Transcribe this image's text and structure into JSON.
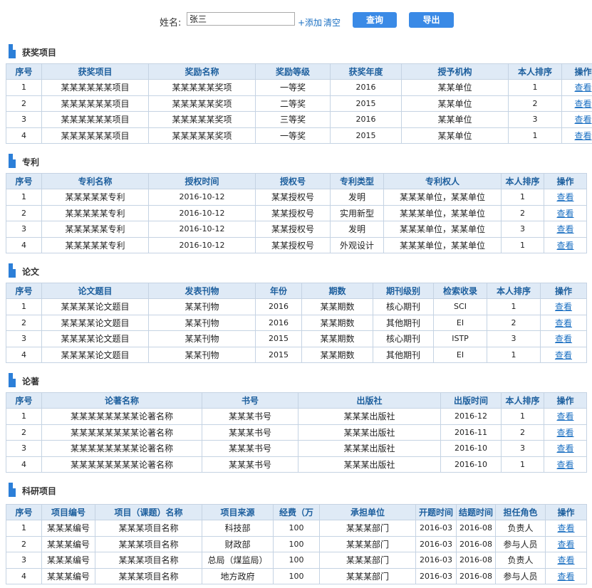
{
  "search": {
    "label": "姓名:",
    "value": "张三",
    "add": "+添加",
    "clear": "清空",
    "query": "查询",
    "export": "导出"
  },
  "view_label": "查看",
  "sections": [
    {
      "title": "获奖项目",
      "headers": [
        "序号",
        "获奖项目",
        "奖励名称",
        "奖励等级",
        "获奖年度",
        "授予机构",
        "本人排序",
        "操作"
      ],
      "rows": [
        [
          "1",
          "某某某某某某项目",
          "某某某某某奖项",
          "一等奖",
          "2016",
          "某某单位",
          "1"
        ],
        [
          "2",
          "某某某某某某项目",
          "某某某某某奖项",
          "二等奖",
          "2015",
          "某某单位",
          "2"
        ],
        [
          "3",
          "某某某某某某项目",
          "某某某某某奖项",
          "三等奖",
          "2016",
          "某某单位",
          "3"
        ],
        [
          "4",
          "某某某某某某项目",
          "某某某某某奖项",
          "一等奖",
          "2015",
          "某某单位",
          "1"
        ]
      ]
    },
    {
      "title": "专利",
      "headers": [
        "序号",
        "专利名称",
        "授权时间",
        "授权号",
        "专利类型",
        "专利权人",
        "本人排序",
        "操作"
      ],
      "rows": [
        [
          "1",
          "某某某某某专利",
          "2016-10-12",
          "某某授权号",
          "发明",
          "某某某单位，某某单位",
          "1"
        ],
        [
          "2",
          "某某某某某专利",
          "2016-10-12",
          "某某授权号",
          "实用新型",
          "某某某单位，某某单位",
          "2"
        ],
        [
          "3",
          "某某某某某专利",
          "2016-10-12",
          "某某授权号",
          "发明",
          "某某某单位，某某单位",
          "3"
        ],
        [
          "4",
          "某某某某某专利",
          "2016-10-12",
          "某某授权号",
          "外观设计",
          "某某某单位，某某单位",
          "1"
        ]
      ]
    },
    {
      "title": "论文",
      "headers": [
        "序号",
        "论文题目",
        "发表刊物",
        "年份",
        "期数",
        "期刊级别",
        "检索收录",
        "本人排序",
        "操作"
      ],
      "rows": [
        [
          "1",
          "某某某某论文题目",
          "某某刊物",
          "2016",
          "某某期数",
          "核心期刊",
          "SCI",
          "1"
        ],
        [
          "2",
          "某某某某论文题目",
          "某某刊物",
          "2016",
          "某某期数",
          "其他期刊",
          "EI",
          "2"
        ],
        [
          "3",
          "某某某某论文题目",
          "某某刊物",
          "2015",
          "某某期数",
          "核心期刊",
          "ISTP",
          "3"
        ],
        [
          "4",
          "某某某某论文题目",
          "某某刊物",
          "2015",
          "某某期数",
          "其他期刊",
          "EI",
          "1"
        ]
      ]
    },
    {
      "title": "论著",
      "headers": [
        "序号",
        "论著名称",
        "书号",
        "出版社",
        "出版时间",
        "本人排序",
        "操作"
      ],
      "rows": [
        [
          "1",
          "某某某某某某某某论著名称",
          "某某某书号",
          "某某某出版社",
          "2016-12",
          "1"
        ],
        [
          "2",
          "某某某某某某某某论著名称",
          "某某某书号",
          "某某某出版社",
          "2016-11",
          "2"
        ],
        [
          "3",
          "某某某某某某某某论著名称",
          "某某某书号",
          "某某某出版社",
          "2016-10",
          "3"
        ],
        [
          "4",
          "某某某某某某某某论著名称",
          "某某某书号",
          "某某某出版社",
          "2016-10",
          "1"
        ]
      ]
    },
    {
      "title": "科研项目",
      "headers": [
        "序号",
        "项目编号",
        "项目（课题）名称",
        "项目来源",
        "经费（万",
        "承担单位",
        "开题时间",
        "结题时间",
        "担任角色",
        "操作"
      ],
      "rows": [
        [
          "1",
          "某某某编号",
          "某某某项目名称",
          "科技部",
          "100",
          "某某某部门",
          "2016-03",
          "2016-08",
          "负责人"
        ],
        [
          "2",
          "某某某编号",
          "某某某项目名称",
          "财政部",
          "100",
          "某某某部门",
          "2016-03",
          "2016-08",
          "参与人员"
        ],
        [
          "3",
          "某某某编号",
          "某某某项目名称",
          "总局（煤监局）",
          "100",
          "某某某部门",
          "2016-03",
          "2016-08",
          "负责人"
        ],
        [
          "4",
          "某某某编号",
          "某某某项目名称",
          "地方政府",
          "100",
          "某某某部门",
          "2016-03",
          "2016-08",
          "参与人员"
        ]
      ]
    }
  ]
}
